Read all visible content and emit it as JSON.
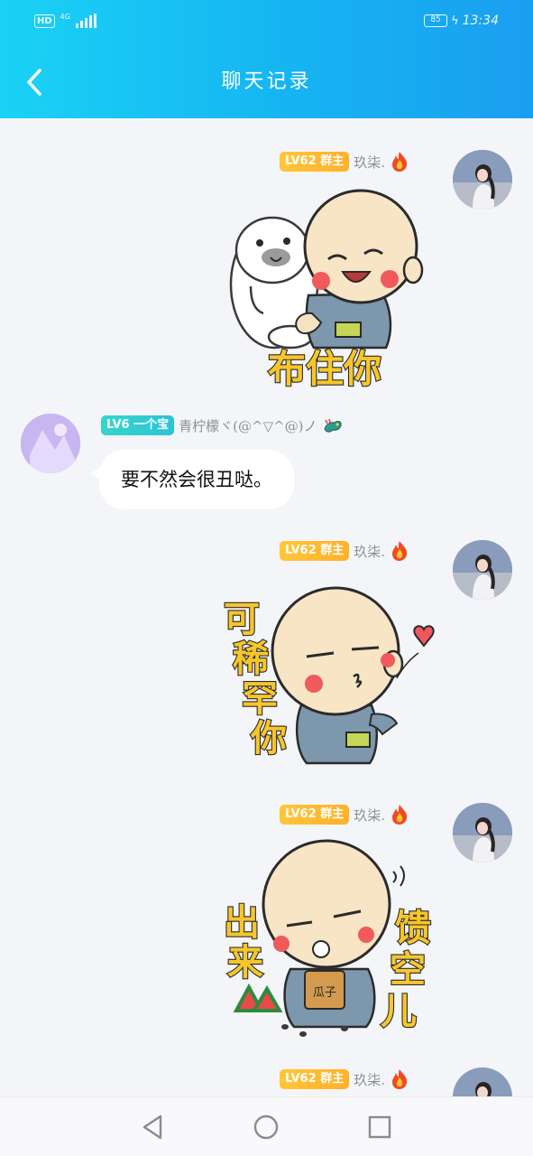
{
  "status_bar": {
    "hd": "HD",
    "network": "4G",
    "battery": "85",
    "time": "13:34"
  },
  "header": {
    "title": "聊天记录",
    "back_icon": "chevron-left-icon"
  },
  "colors": {
    "header_gradient": [
      "#1ad2f5",
      "#1a9ef0"
    ],
    "owner_badge": "#ffb82f",
    "member_badge": "#2cc9cf",
    "background": "#f4f5f9"
  },
  "messages": [
    {
      "side": "right",
      "sender": {
        "level": "LV62",
        "title": "群主",
        "name": "玖柒.",
        "emblem": "fire-icon",
        "avatar": "girl-avatar"
      },
      "kind": "sticker",
      "sticker_text": "布住你"
    },
    {
      "side": "left",
      "sender": {
        "level": "LV6",
        "title": "一个宝",
        "name": "青柠檬ヾ(@^▽^@)ノ",
        "emblem": "dragon-icon",
        "avatar": "purple-avatar"
      },
      "kind": "text",
      "text": "要不然会很丑哒。"
    },
    {
      "side": "right",
      "sender": {
        "level": "LV62",
        "title": "群主",
        "name": "玖柒.",
        "emblem": "fire-icon",
        "avatar": "girl-avatar"
      },
      "kind": "sticker",
      "sticker_text": [
        "可",
        "稀",
        "罕",
        "你"
      ]
    },
    {
      "side": "right",
      "sender": {
        "level": "LV62",
        "title": "群主",
        "name": "玖柒.",
        "emblem": "fire-icon",
        "avatar": "girl-avatar"
      },
      "kind": "sticker",
      "sticker_text": {
        "left": [
          "出",
          "来"
        ],
        "right": [
          "馈",
          "空",
          "儿"
        ],
        "bag": "瓜子"
      }
    },
    {
      "side": "right",
      "sender": {
        "level": "LV62",
        "title": "群主",
        "name": "玖柒.",
        "emblem": "fire-icon",
        "avatar": "girl-avatar"
      },
      "kind": "partial"
    }
  ],
  "nav_bar": {
    "back": "triangle-back-icon",
    "home": "circle-home-icon",
    "recent": "square-recent-icon"
  }
}
